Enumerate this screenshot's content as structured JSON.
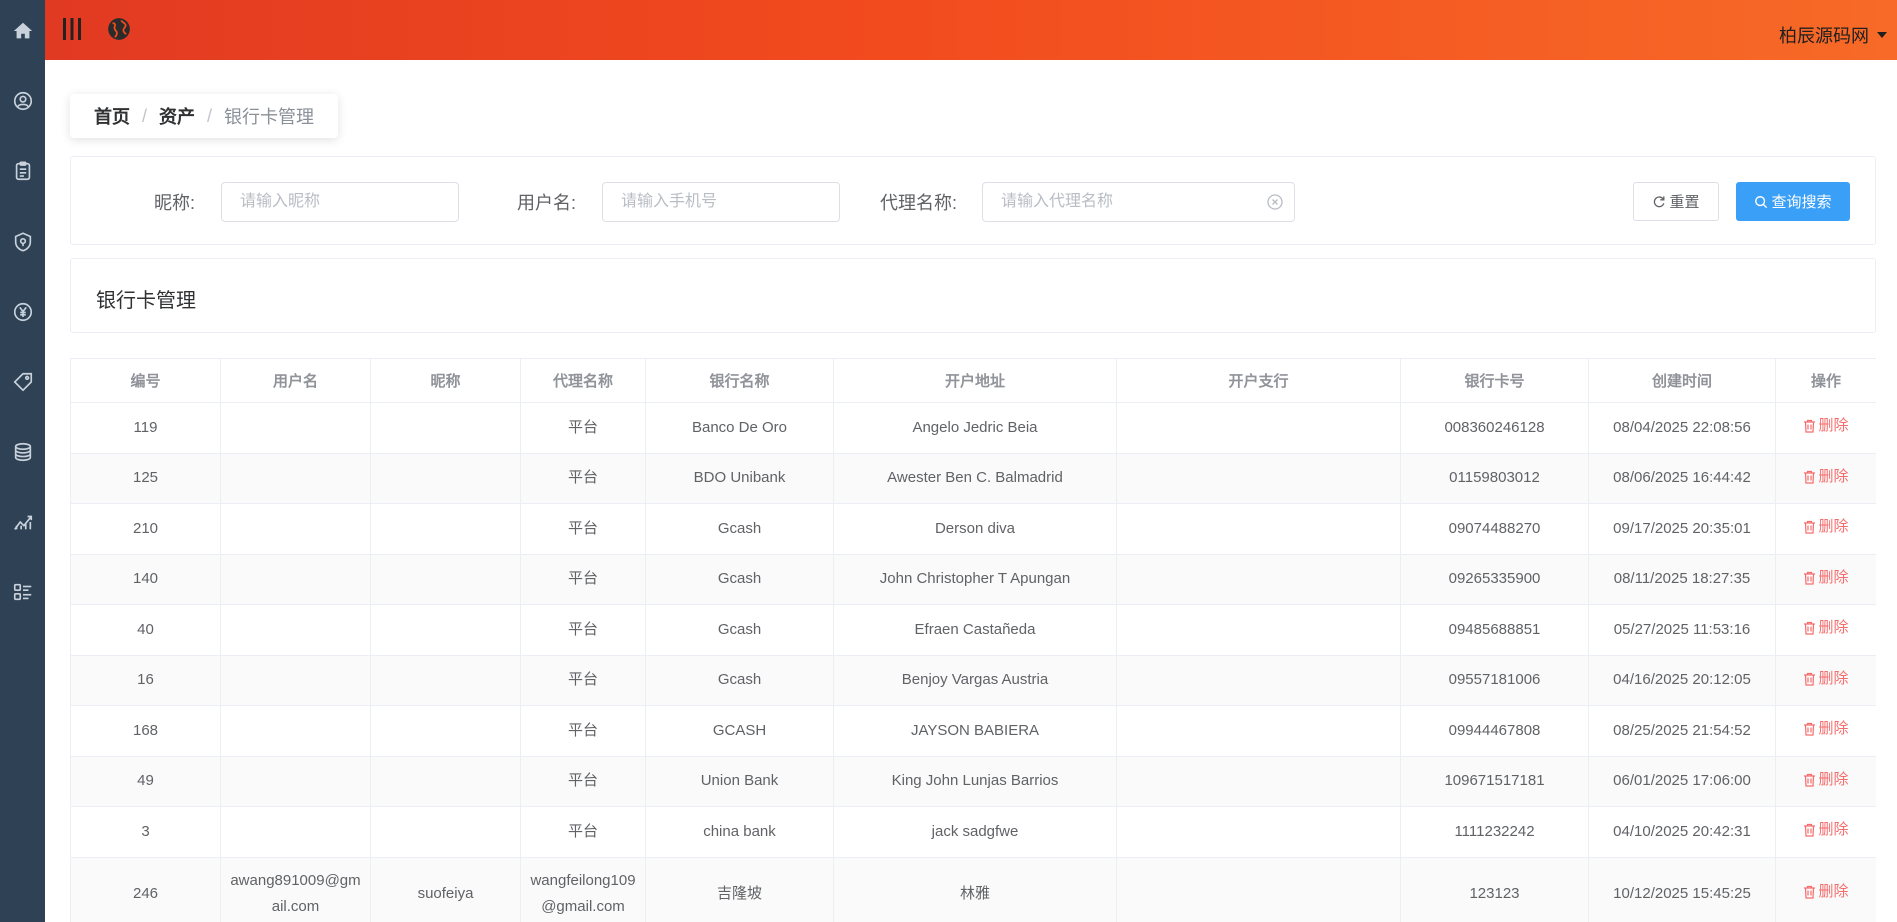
{
  "header": {
    "user_name": "柏辰源码网"
  },
  "breadcrumb": {
    "home": "首页",
    "section": "资产",
    "current": "银行卡管理"
  },
  "search": {
    "nickname_label": "昵称:",
    "nickname_placeholder": "请输入昵称",
    "username_label": "用户名:",
    "username_placeholder": "请输入手机号",
    "agent_label": "代理名称:",
    "agent_placeholder": "请输入代理名称",
    "reset_label": "重置",
    "search_label": "查询搜索"
  },
  "panel_title": "银行卡管理",
  "table": {
    "columns": [
      "编号",
      "用户名",
      "昵称",
      "代理名称",
      "银行名称",
      "开户地址",
      "开户支行",
      "银行卡号",
      "创建时间",
      "操作"
    ],
    "delete_label": "删除",
    "rows": [
      {
        "id": "119",
        "username": "",
        "nickname": "",
        "agent": "平台",
        "bank": "Banco De Oro",
        "address": "Angelo Jedric Beia",
        "branch": "",
        "card": "008360246128",
        "created": "08/04/2025 22:08:56"
      },
      {
        "id": "125",
        "username": "",
        "nickname": "",
        "agent": "平台",
        "bank": "BDO Unibank",
        "address": "Awester Ben C. Balmadrid",
        "branch": "",
        "card": "01159803012",
        "created": "08/06/2025 16:44:42"
      },
      {
        "id": "210",
        "username": "",
        "nickname": "",
        "agent": "平台",
        "bank": "Gcash",
        "address": "Derson diva",
        "branch": "",
        "card": "09074488270",
        "created": "09/17/2025 20:35:01"
      },
      {
        "id": "140",
        "username": "",
        "nickname": "",
        "agent": "平台",
        "bank": "Gcash",
        "address": "John Christopher T Apungan",
        "branch": "",
        "card": "09265335900",
        "created": "08/11/2025 18:27:35"
      },
      {
        "id": "40",
        "username": "",
        "nickname": "",
        "agent": "平台",
        "bank": "Gcash",
        "address": "Efraen Castañeda",
        "branch": "",
        "card": "09485688851",
        "created": "05/27/2025 11:53:16"
      },
      {
        "id": "16",
        "username": "",
        "nickname": "",
        "agent": "平台",
        "bank": "Gcash",
        "address": "Benjoy Vargas Austria",
        "branch": "",
        "card": "09557181006",
        "created": "04/16/2025 20:12:05"
      },
      {
        "id": "168",
        "username": "",
        "nickname": "",
        "agent": "平台",
        "bank": "GCASH",
        "address": "JAYSON BABIERA",
        "branch": "",
        "card": "09944467808",
        "created": "08/25/2025 21:54:52"
      },
      {
        "id": "49",
        "username": "",
        "nickname": "",
        "agent": "平台",
        "bank": "Union Bank",
        "address": "King John Lunjas Barrios",
        "branch": "",
        "card": "109671517181",
        "created": "06/01/2025 17:06:00"
      },
      {
        "id": "3",
        "username": "",
        "nickname": "",
        "agent": "平台",
        "bank": "china bank",
        "address": "jack sadgfwe",
        "branch": "",
        "card": "1111232242",
        "created": "04/10/2025 20:42:31"
      },
      {
        "id": "246",
        "username": "awang891009@gmail.com",
        "nickname": "suofeiya",
        "agent": "wangfeilong109@gmail.com",
        "bank": "吉隆坡",
        "address": "林雅",
        "branch": "",
        "card": "123123",
        "created": "10/12/2025 15:45:25"
      }
    ]
  }
}
